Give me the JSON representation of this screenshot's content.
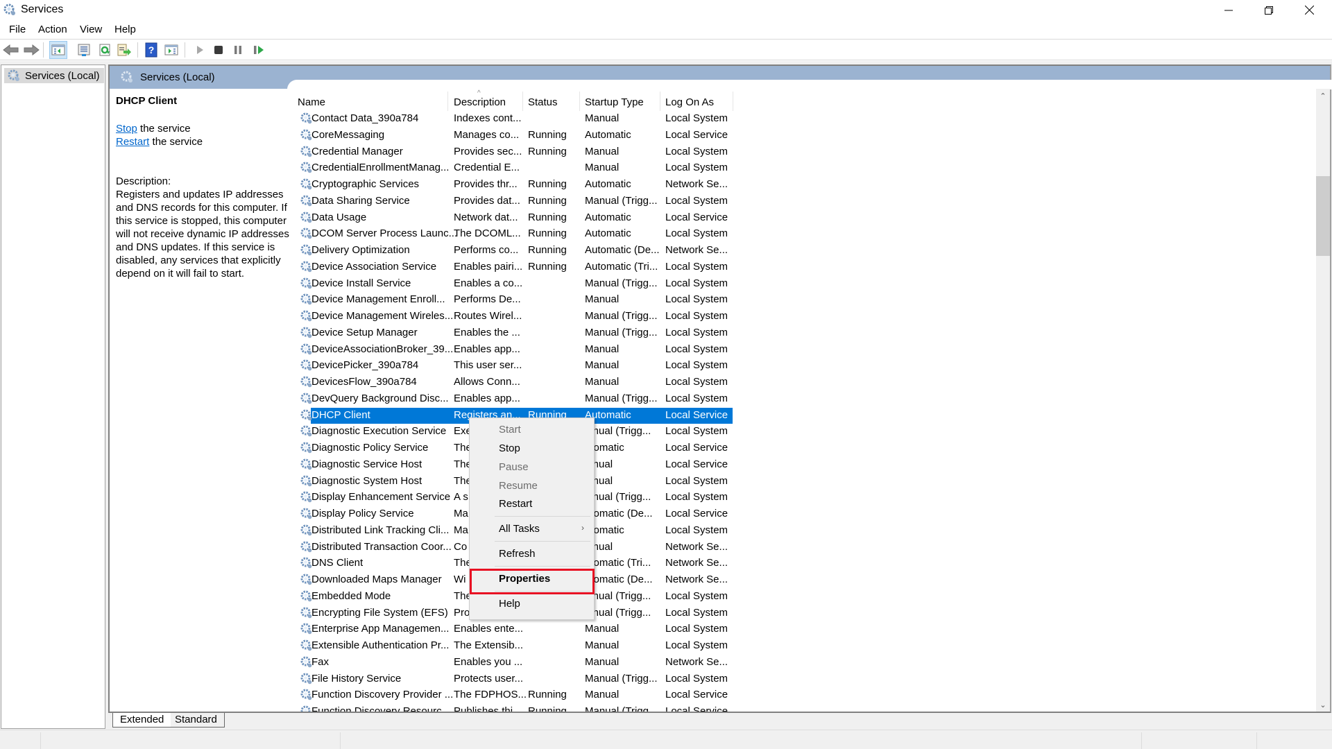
{
  "window": {
    "title": "Services",
    "controls": {
      "minimize": "minimize",
      "maximize": "restore",
      "close": "close"
    }
  },
  "menubar": {
    "items": [
      "File",
      "Action",
      "View",
      "Help"
    ]
  },
  "toolbar": {
    "buttons": [
      "back-icon",
      "forward-icon",
      "show-hide-console-tree-icon",
      "properties-icon",
      "refresh-icon",
      "export-list-icon",
      "help-icon",
      "show-hide-action-pane-icon",
      "start-service-icon",
      "stop-service-icon",
      "pause-service-icon",
      "restart-service-icon"
    ]
  },
  "tree": {
    "root": "Services (Local)"
  },
  "main": {
    "header": "Services (Local)",
    "details": {
      "title": "DHCP Client",
      "stop_link": "Stop",
      "stop_suffix": " the service",
      "restart_link": "Restart",
      "restart_suffix": " the service",
      "description_label": "Description:",
      "description": "Registers and updates IP addresses and DNS records for this computer. If this service is stopped, this computer will not receive dynamic IP addresses and DNS updates. If this service is disabled, any services that explicitly depend on it will fail to start."
    },
    "columns": [
      "Name",
      "Description",
      "Status",
      "Startup Type",
      "Log On As"
    ],
    "sort_column": "Name",
    "rows": [
      {
        "name": "Contact Data_390a784",
        "desc": "Indexes cont...",
        "status": "",
        "startup": "Manual",
        "logon": "Local System"
      },
      {
        "name": "CoreMessaging",
        "desc": "Manages co...",
        "status": "Running",
        "startup": "Automatic",
        "logon": "Local Service"
      },
      {
        "name": "Credential Manager",
        "desc": "Provides sec...",
        "status": "Running",
        "startup": "Manual",
        "logon": "Local System"
      },
      {
        "name": "CredentialEnrollmentManag...",
        "desc": "Credential E...",
        "status": "",
        "startup": "Manual",
        "logon": "Local System"
      },
      {
        "name": "Cryptographic Services",
        "desc": "Provides thr...",
        "status": "Running",
        "startup": "Automatic",
        "logon": "Network Se..."
      },
      {
        "name": "Data Sharing Service",
        "desc": "Provides dat...",
        "status": "Running",
        "startup": "Manual (Trigg...",
        "logon": "Local System"
      },
      {
        "name": "Data Usage",
        "desc": "Network dat...",
        "status": "Running",
        "startup": "Automatic",
        "logon": "Local Service"
      },
      {
        "name": "DCOM Server Process Launc...",
        "desc": "The DCOML...",
        "status": "Running",
        "startup": "Automatic",
        "logon": "Local System"
      },
      {
        "name": "Delivery Optimization",
        "desc": "Performs co...",
        "status": "Running",
        "startup": "Automatic (De...",
        "logon": "Network Se..."
      },
      {
        "name": "Device Association Service",
        "desc": "Enables pairi...",
        "status": "Running",
        "startup": "Automatic (Tri...",
        "logon": "Local System"
      },
      {
        "name": "Device Install Service",
        "desc": "Enables a co...",
        "status": "",
        "startup": "Manual (Trigg...",
        "logon": "Local System"
      },
      {
        "name": "Device Management Enroll...",
        "desc": "Performs De...",
        "status": "",
        "startup": "Manual",
        "logon": "Local System"
      },
      {
        "name": "Device Management Wireles...",
        "desc": "Routes Wirel...",
        "status": "",
        "startup": "Manual (Trigg...",
        "logon": "Local System"
      },
      {
        "name": "Device Setup Manager",
        "desc": "Enables the ...",
        "status": "",
        "startup": "Manual (Trigg...",
        "logon": "Local System"
      },
      {
        "name": "DeviceAssociationBroker_39...",
        "desc": "Enables app...",
        "status": "",
        "startup": "Manual",
        "logon": "Local System"
      },
      {
        "name": "DevicePicker_390a784",
        "desc": "This user ser...",
        "status": "",
        "startup": "Manual",
        "logon": "Local System"
      },
      {
        "name": "DevicesFlow_390a784",
        "desc": "Allows Conn...",
        "status": "",
        "startup": "Manual",
        "logon": "Local System"
      },
      {
        "name": "DevQuery Background Disc...",
        "desc": "Enables app...",
        "status": "",
        "startup": "Manual (Trigg...",
        "logon": "Local System"
      },
      {
        "name": "DHCP Client",
        "desc": "Registers an...",
        "status": "Running",
        "startup": "Automatic",
        "logon": "Local Service",
        "selected": true
      },
      {
        "name": "Diagnostic Execution Service",
        "desc": "Exe",
        "status": "",
        "startup": "lanual (Trigg...",
        "logon": "Local System"
      },
      {
        "name": "Diagnostic Policy Service",
        "desc": "The",
        "status": "",
        "startup": "utomatic",
        "logon": "Local Service"
      },
      {
        "name": "Diagnostic Service Host",
        "desc": "The",
        "status": "",
        "startup": "lanual",
        "logon": "Local Service"
      },
      {
        "name": "Diagnostic System Host",
        "desc": "The",
        "status": "",
        "startup": "lanual",
        "logon": "Local System"
      },
      {
        "name": "Display Enhancement Service",
        "desc": "A s",
        "status": "",
        "startup": "lanual (Trigg...",
        "logon": "Local System"
      },
      {
        "name": "Display Policy Service",
        "desc": "Ma",
        "status": "",
        "startup": "utomatic (De...",
        "logon": "Local Service"
      },
      {
        "name": "Distributed Link Tracking Cli...",
        "desc": "Ma",
        "status": "",
        "startup": "utomatic",
        "logon": "Local System"
      },
      {
        "name": "Distributed Transaction Coor...",
        "desc": "Co",
        "status": "",
        "startup": "lanual",
        "logon": "Network Se..."
      },
      {
        "name": "DNS Client",
        "desc": "The",
        "status": "",
        "startup": "utomatic (Tri...",
        "logon": "Network Se..."
      },
      {
        "name": "Downloaded Maps Manager",
        "desc": "Wi",
        "status": "",
        "startup": "utomatic (De...",
        "logon": "Network Se..."
      },
      {
        "name": "Embedded Mode",
        "desc": "The",
        "status": "",
        "startup": "lanual (Trigg...",
        "logon": "Local System"
      },
      {
        "name": "Encrypting File System (EFS)",
        "desc": "Pro",
        "status": "",
        "startup": "lanual (Trigg...",
        "logon": "Local System"
      },
      {
        "name": "Enterprise App Managemen...",
        "desc": "Enables ente...",
        "status": "",
        "startup": "Manual",
        "logon": "Local System"
      },
      {
        "name": "Extensible Authentication Pr...",
        "desc": "The Extensib...",
        "status": "",
        "startup": "Manual",
        "logon": "Local System"
      },
      {
        "name": "Fax",
        "desc": "Enables you ...",
        "status": "",
        "startup": "Manual",
        "logon": "Network Se..."
      },
      {
        "name": "File History Service",
        "desc": "Protects user...",
        "status": "",
        "startup": "Manual (Trigg...",
        "logon": "Local System"
      },
      {
        "name": "Function Discovery Provider ...",
        "desc": "The FDPHOS...",
        "status": "Running",
        "startup": "Manual",
        "logon": "Local Service"
      },
      {
        "name": "Function Discovery Resourc...",
        "desc": "Publishes thi...",
        "status": "Running",
        "startup": "Manual (Trigg...",
        "logon": "Local Service"
      }
    ],
    "scrollbar": {
      "position_fraction": 0.14,
      "visible_fraction": 0.13
    }
  },
  "tabs": {
    "items": [
      "Extended",
      "Standard"
    ],
    "active": "Extended"
  },
  "context_menu": {
    "items": [
      {
        "label": "Start",
        "enabled": false
      },
      {
        "label": "Stop",
        "enabled": true
      },
      {
        "label": "Pause",
        "enabled": false
      },
      {
        "label": "Resume",
        "enabled": false
      },
      {
        "label": "Restart",
        "enabled": true
      },
      {
        "label": "All Tasks",
        "enabled": true,
        "submenu": true
      },
      {
        "label": "Refresh",
        "enabled": true
      },
      {
        "label": "Properties",
        "enabled": true,
        "default": true,
        "highlighted": true
      },
      {
        "label": "Help",
        "enabled": true
      }
    ],
    "submenu_glyph": "›"
  },
  "colors": {
    "selection": "#0078d7",
    "header_band": "#9bb3d1",
    "highlight_box": "#e81123",
    "link": "#0066cc"
  }
}
